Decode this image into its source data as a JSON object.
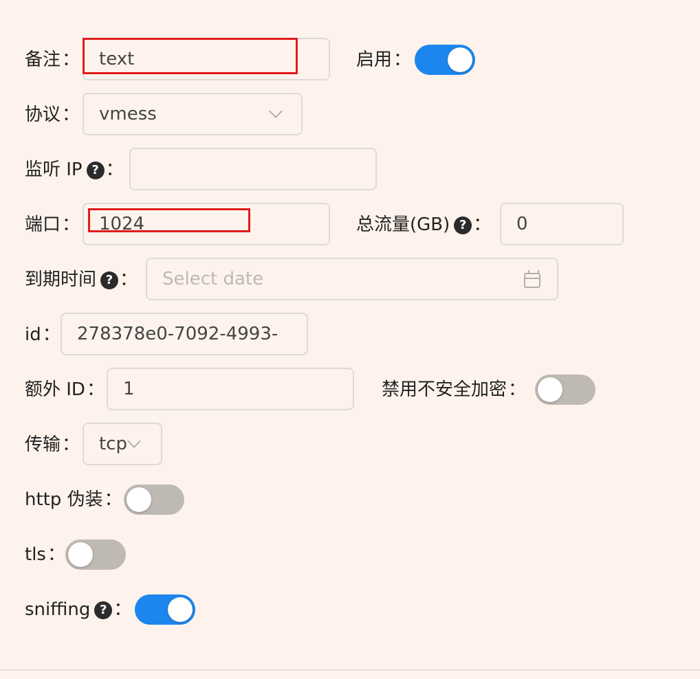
{
  "remark": {
    "label": "备注",
    "value": "text"
  },
  "enable": {
    "label": "启用",
    "on": true
  },
  "protocol": {
    "label": "协议",
    "value": "vmess"
  },
  "listen_ip": {
    "label": "监听 IP",
    "value": ""
  },
  "port": {
    "label": "端口",
    "value": "1024"
  },
  "total_traffic": {
    "label": "总流量(GB)",
    "value": "0"
  },
  "expiry": {
    "label": "到期时间",
    "placeholder": "Select date"
  },
  "id": {
    "label": "id",
    "value": "278378e0-7092-4993-"
  },
  "alter_id": {
    "label": "额外 ID",
    "value": "1"
  },
  "disable_insecure": {
    "label": "禁用不安全加密",
    "on": false
  },
  "transport": {
    "label": "传输",
    "value": "tcp"
  },
  "http_camouflage": {
    "label": "http 伪装",
    "on": false
  },
  "tls": {
    "label": "tls",
    "on": false
  },
  "sniffing": {
    "label": "sniffing",
    "on": true
  },
  "colon": "：",
  "help_glyph": "?",
  "colors": {
    "switch_on": "#1d86ee",
    "switch_off": "#bfb9b3",
    "highlight": "#e01b1b",
    "background": "#fdf3ec"
  },
  "icons": [
    "help-icon",
    "chevron-down-icon",
    "calendar-icon"
  ]
}
